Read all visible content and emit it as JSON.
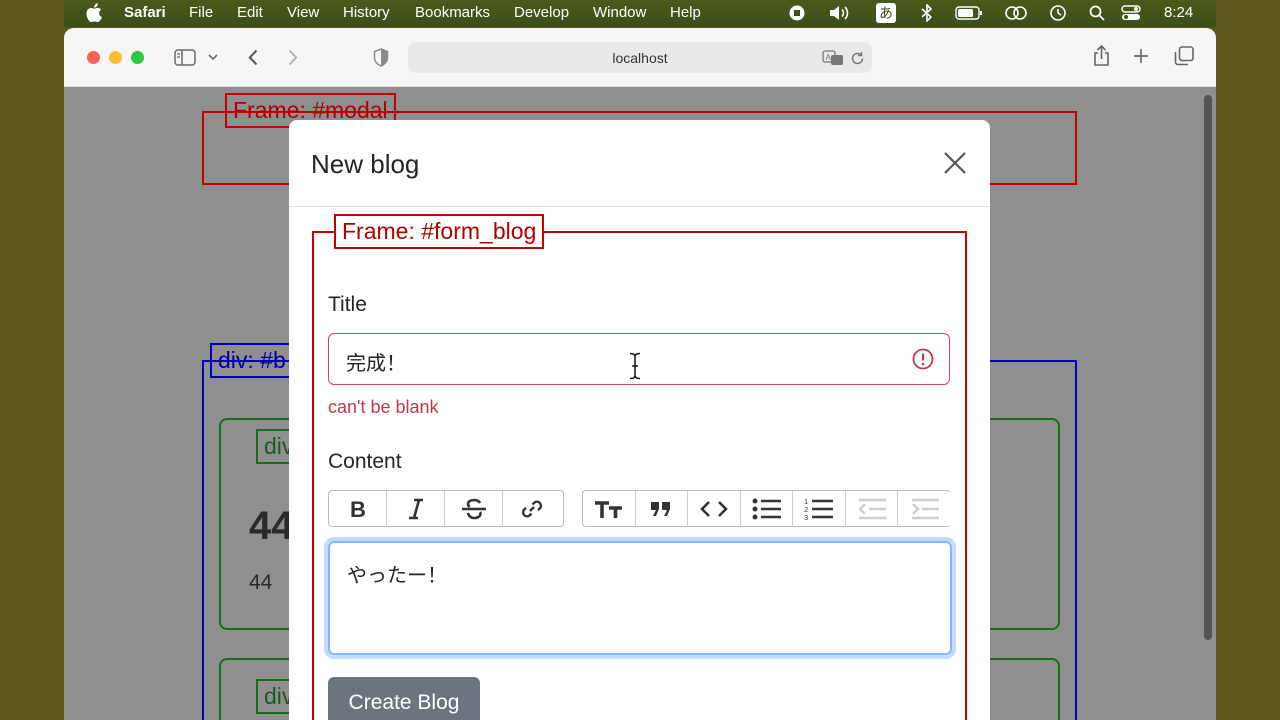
{
  "menubar": {
    "app": "Safari",
    "items": [
      "File",
      "Edit",
      "View",
      "History",
      "Bookmarks",
      "Develop",
      "Window",
      "Help"
    ],
    "input_method": "あ",
    "time": "8:24"
  },
  "browser": {
    "url": "localhost"
  },
  "page": {
    "frame_modal_label": "Frame: #modal",
    "div_blogs_label": "div: #b",
    "div_blog_label": "div",
    "div_blog2_label": "div",
    "blog_title": "44",
    "blog_content": "44"
  },
  "modal": {
    "title": "New blog",
    "form_frame_label": "Frame: #form_blog",
    "title_label": "Title",
    "title_value": "完成！",
    "title_error": "can't be blank",
    "content_label": "Content",
    "content_value": "やったー！",
    "submit_label": "Create Blog"
  },
  "toolbar_buttons": {
    "text_tools": [
      "bold-icon",
      "italic-icon",
      "strikethrough-icon",
      "link-icon"
    ],
    "block_tools": [
      "heading-icon",
      "quote-icon",
      "code-icon",
      "bullet-list-icon",
      "number-list-icon",
      "outdent-icon",
      "indent-icon"
    ]
  },
  "colors": {
    "frame_red": "#c40000",
    "frame_blue": "#0000b8",
    "frame_green": "#1a6b1a",
    "invalid": "#c0384a",
    "focus": "#86b7fe",
    "button": "#6c757d"
  }
}
